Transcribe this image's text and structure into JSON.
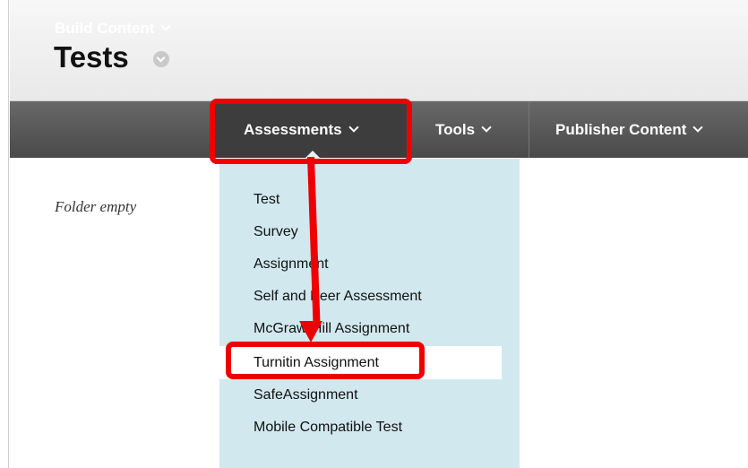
{
  "header": {
    "title": "Tests"
  },
  "toolbar": {
    "build_content": "Build Content",
    "assessments": "Assessments",
    "tools": "Tools",
    "publisher_content": "Publisher Content"
  },
  "content": {
    "empty_message": "Folder empty"
  },
  "dropdown": {
    "items": [
      "Test",
      "Survey",
      "Assignment",
      "Self and Peer Assessment",
      "McGraw-Hill Assignment",
      "Turnitin Assignment",
      "SafeAssignment",
      "Mobile Compatible Test"
    ],
    "highlighted": "Turnitin Assignment"
  },
  "colors": {
    "annotation": "#ee0000",
    "toolbar": "#555555",
    "dropdown_bg": "#d1e8ee"
  }
}
